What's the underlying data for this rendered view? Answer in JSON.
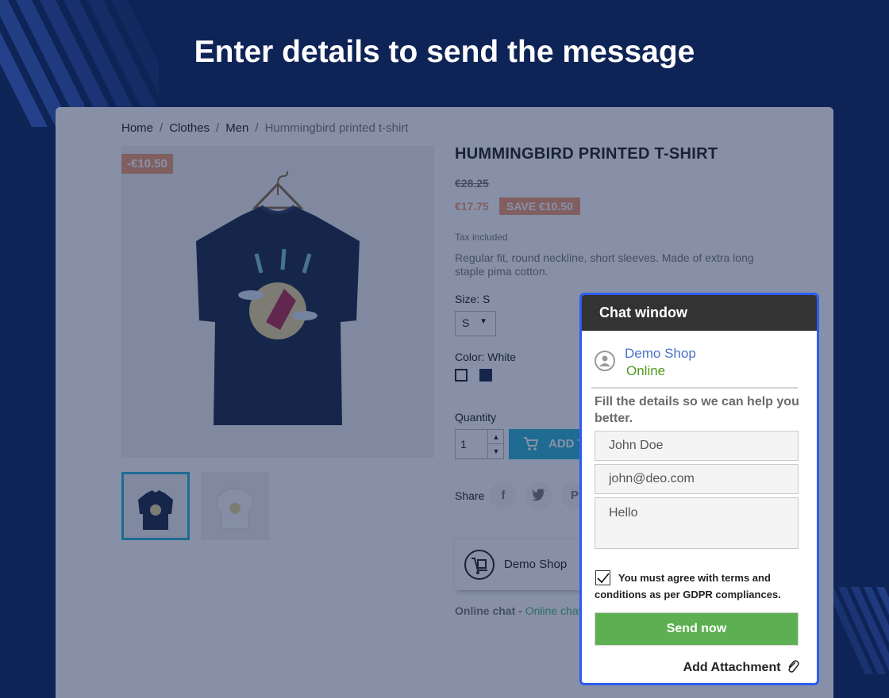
{
  "headline": "Enter details to send the message",
  "breadcrumb": {
    "home": "Home",
    "sep": "/",
    "clothes": "Clothes",
    "men": "Men",
    "current": "Hummingbird printed t-shirt"
  },
  "product": {
    "discount_badge": "-€10.50",
    "title": "HUMMINGBIRD PRINTED T-SHIRT",
    "old_price": "€28.25",
    "price": "€17.75",
    "save_badge": "SAVE €10.50",
    "tax": "Tax included",
    "description": "Regular fit, round neckline, short sleeves. Made of extra long staple pima cotton.",
    "size_label": "Size: S",
    "size_value": "S",
    "color_label": "Color: White",
    "quantity_label": "Quantity",
    "quantity_value": "1",
    "add_to_cart": "ADD TO CART",
    "share_label": "Share",
    "share_facebook": "f",
    "share_pinterest": "P"
  },
  "seller": {
    "name": "Demo Shop",
    "online_chat_label": "Online chat",
    "online_chat_status": "Online chat"
  },
  "chat": {
    "title": "Chat window",
    "agent_name": "Demo Shop",
    "agent_status": "Online",
    "intro": "Fill the details so we can help you better.",
    "name_value": "John Doe",
    "email_value": "john@deo.com",
    "message_value": "Hello",
    "gdpr_text": "You must agree with terms and conditions as per GDPR compliances.",
    "gdpr_checked": true,
    "send_label": "Send now",
    "attach_label": "Add Attachment"
  },
  "colors": {
    "background": "#0f2456",
    "chat_border": "#2f5cf0",
    "chat_header": "#333333",
    "send_button": "#5db052",
    "online_green": "#4f9a1e",
    "agent_link": "#4a72c4",
    "discount": "#f39d72",
    "add_to_cart": "#2fb5d2"
  },
  "icons": [
    "user-circle-icon",
    "checkmark-icon",
    "paperclip-icon",
    "cart-icon",
    "facebook-icon",
    "twitter-icon",
    "pinterest-icon",
    "chevron-up-icon",
    "chevron-down-icon",
    "dropdown-caret-icon",
    "hand-truck-icon"
  ]
}
